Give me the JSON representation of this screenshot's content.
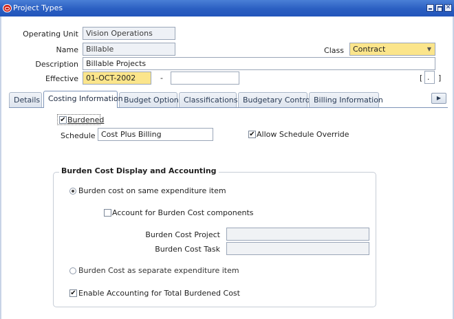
{
  "window": {
    "title": "Project Types"
  },
  "form": {
    "operating_unit_label": "Operating Unit",
    "operating_unit_value": "Vision Operations",
    "name_label": "Name",
    "name_value": "Billable",
    "class_label": "Class",
    "class_value": "Contract",
    "description_label": "Description",
    "description_value": "Billable Projects",
    "effective_label": "Effective",
    "effective_from": "01-OCT-2002",
    "effective_sep": "-",
    "effective_to": "",
    "flex_open": "[",
    "flex_mid": ".",
    "flex_close": "]"
  },
  "tabs": [
    {
      "label": "Details",
      "active": false
    },
    {
      "label": "Costing Information",
      "active": true
    },
    {
      "label": "Budget Option",
      "active": false
    },
    {
      "label": "Classifications",
      "active": false
    },
    {
      "label": "Budgetary Control",
      "active": false
    },
    {
      "label": "Billing Information",
      "active": false
    }
  ],
  "costing": {
    "burdened_label": "Burdened",
    "burdened_checked": true,
    "schedule_label": "Schedule",
    "schedule_value": "Cost Plus Billing",
    "allow_override_label": "Allow Schedule Override",
    "allow_override_checked": true,
    "group_title": "Burden Cost Display and Accounting",
    "radio_same_label": "Burden cost on same expenditure item",
    "account_components_label": "Account for Burden Cost components",
    "burden_cost_project_label": "Burden Cost Project",
    "burden_cost_project_value": "",
    "burden_cost_task_label": "Burden Cost Task",
    "burden_cost_task_value": "",
    "radio_separate_label": "Burden Cost as separate expenditure item",
    "enable_accounting_label": "Enable Accounting for Total Burdened Cost",
    "enable_accounting_checked": true
  },
  "icons": {
    "checkmark": "✔",
    "dropdown": "▼",
    "tab_scroll": "▶"
  },
  "colors": {
    "titlebar": "#2a5ec1",
    "required_field": "#fbe58b",
    "readonly_field": "#eef1f6"
  }
}
